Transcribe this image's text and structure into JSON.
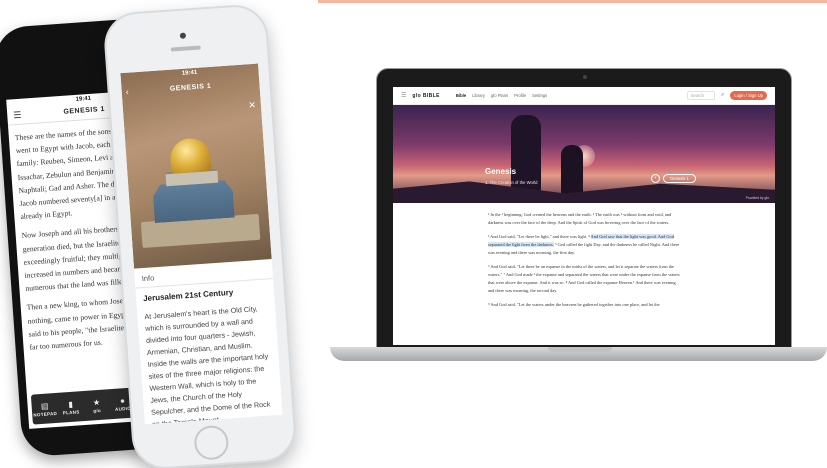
{
  "colors": {
    "accent": "#e46a4c",
    "highlight": "#d6e4f7",
    "top_accent": "#f6b79e"
  },
  "phone_back": {
    "time": "19:41",
    "title": "GENESIS 1",
    "paragraphs": [
      "These are the names of the sons of Israel who went to Egypt with Jacob, each with his family: Reuben, Simeon, Levi and Judah; Issachar, Zebulun and Benjamin; Dan and Naphtali; Gad and Asher. The descendants of Jacob numbered seventy[a] in all; Joseph was already in Egypt.",
      "Now Joseph and all his brothers and all that generation died, but the Israelites were exceedingly fruitful; they multiplied greatly, increased in numbers and became so numerous that the land was filled with them.",
      "Then a new king, to whom Joseph meant nothing, came to power in Egypt. \"Look,\" he said to his people, \"the Israelites have become far too numerous for us."
    ],
    "toolbar": [
      {
        "icon": "notepad-icon",
        "glyph": "▤",
        "label": "NOTEPAD"
      },
      {
        "icon": "plans-icon",
        "glyph": "▮",
        "label": "PLANS"
      },
      {
        "icon": "star-icon",
        "glyph": "★",
        "label": "g/u"
      },
      {
        "icon": "mic-icon",
        "glyph": "●",
        "label": "AUDIO"
      }
    ]
  },
  "phone_front": {
    "time": "19:41",
    "title": "GENESIS 1",
    "info_label": "Info",
    "heading": "Jerusalem 21st Century",
    "body": "At Jerusalem's heart is the Old City, which is surrounded by a wall and divided into four quarters - Jewish, Armenian, Christian, and Muslim. Inside the walls are the important holy sites of the three major religions: the Western Wall, which is holy to the Jews, the Church of the Holy Sepulcher, and the Dome of the Rock on the Temple Mount."
  },
  "laptop": {
    "logo": "glo BIBLE",
    "nav": [
      "Bible",
      "Library",
      "glo Plans",
      "Profile",
      "Settings"
    ],
    "search_placeholder": "Search",
    "login_label": "Login / Sign Up",
    "hero": {
      "book": "Genesis",
      "subtitle": "1. The Creation of the World",
      "chapter_select": "Genesis 1",
      "credit": "Provided by glo"
    },
    "verses": {
      "p1": "¹ In the ¹ beginning, God created the heavens and the earth. ² The earth was ¹ without form and void, and darkness was over the face of the deep. And the Spirit of God was hovering over the face of the waters.",
      "p2_a": "³ And God said, \"Let there be light,\" and there was light. ⁴ ",
      "p2_hl": "And God saw that the light was good. And God separated the light from the darkness.",
      "p2_b": " ⁵ God called the light Day, and the darkness he called Night. And there was evening and there was morning, the first day.",
      "p3": "⁶ And God said, \"Let there be an expanse in the midst of the waters, and let it separate the waters from the waters.\" ⁷ And God made ¹ the expanse and separated the waters that were under the expanse from the waters that were above the expanse. And it was so. ⁸ And God called the expanse Heaven.¹ And there was evening and there was morning, the second day.",
      "p4": "⁹ And God said, \"Let the waters under the heavens be gathered together into one place, and let the"
    }
  }
}
